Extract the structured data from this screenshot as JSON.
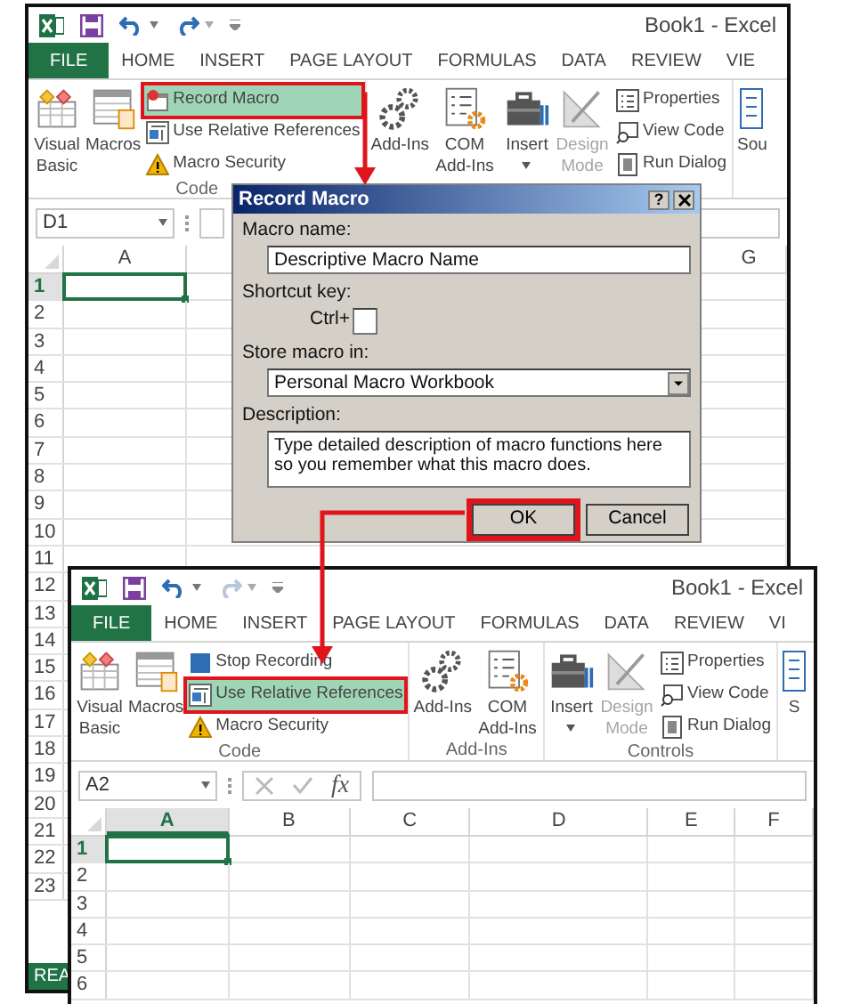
{
  "windows": [
    {
      "title": "Book1 - Excel",
      "redo_enabled": true,
      "tabs": [
        {
          "label": "FILE",
          "kind": "file",
          "selected": false
        },
        {
          "label": "HOME",
          "kind": "tab",
          "selected": false
        },
        {
          "label": "INSERT",
          "kind": "tab",
          "selected": false
        },
        {
          "label": "PAGE LAYOUT",
          "kind": "tab",
          "selected": false
        },
        {
          "label": "FORMULAS",
          "kind": "tab",
          "selected": false
        },
        {
          "label": "DATA",
          "kind": "tab",
          "selected": false
        },
        {
          "label": "REVIEW",
          "kind": "tab",
          "selected": false
        },
        {
          "label": "VIE",
          "kind": "tab",
          "selected": false
        }
      ],
      "groups": [
        {
          "label": "Code",
          "large": [
            {
              "label": "Visual Basic",
              "kind": "visual-basic",
              "disabled": false
            },
            {
              "label": "Macros",
              "kind": "macros",
              "disabled": false
            }
          ],
          "small": [
            {
              "label": "Record Macro",
              "kind": "record",
              "highlighted": true
            },
            {
              "label": "Use Relative References",
              "kind": "relative",
              "highlighted": false
            },
            {
              "label": "Macro Security",
              "kind": "security",
              "highlighted": false
            }
          ]
        },
        {
          "large": [
            {
              "label": "Add-Ins",
              "kind": "add-ins",
              "disabled": false
            },
            {
              "label": "COM Add-Ins",
              "kind": "com",
              "disabled": false
            }
          ]
        },
        {
          "large": [
            {
              "label": "Insert",
              "kind": "insert",
              "disabled": false
            },
            {
              "label": "Design Mode",
              "kind": "design",
              "disabled": true
            }
          ],
          "small": [
            {
              "label": "Properties",
              "kind": "properties",
              "highlighted": false
            },
            {
              "label": "View Code",
              "kind": "view-code",
              "highlighted": false
            },
            {
              "label": "Run Dialog",
              "kind": "run-dialog",
              "highlighted": false
            }
          ]
        },
        {
          "large": [
            {
              "label": "Sou",
              "kind": "source",
              "disabled": false
            }
          ]
        }
      ],
      "name_box": "D1",
      "columns": [
        {
          "label": "A",
          "selected": false
        },
        {
          "label": "G",
          "selected": false
        }
      ],
      "rows": [
        {
          "label": "1",
          "selected": true
        },
        {
          "label": "2",
          "selected": false
        },
        {
          "label": "3",
          "selected": false
        },
        {
          "label": "4",
          "selected": false
        },
        {
          "label": "5",
          "selected": false
        },
        {
          "label": "6",
          "selected": false
        },
        {
          "label": "7",
          "selected": false
        },
        {
          "label": "8",
          "selected": false
        },
        {
          "label": "9",
          "selected": false
        },
        {
          "label": "10",
          "selected": false
        },
        {
          "label": "11",
          "selected": false
        },
        {
          "label": "12",
          "selected": false
        },
        {
          "label": "13",
          "selected": false
        },
        {
          "label": "14",
          "selected": false
        },
        {
          "label": "15",
          "selected": false
        },
        {
          "label": "16",
          "selected": false
        },
        {
          "label": "17",
          "selected": false
        },
        {
          "label": "18",
          "selected": false
        },
        {
          "label": "19",
          "selected": false
        },
        {
          "label": "20",
          "selected": false
        },
        {
          "label": "21",
          "selected": false
        },
        {
          "label": "22",
          "selected": false
        },
        {
          "label": "23",
          "selected": false
        }
      ],
      "status": "REA"
    },
    {
      "title": "Book1 - Excel",
      "redo_enabled": false,
      "tabs": [
        {
          "label": "FILE",
          "kind": "file",
          "selected": false
        },
        {
          "label": "HOME",
          "kind": "tab",
          "selected": false
        },
        {
          "label": "INSERT",
          "kind": "tab",
          "selected": false
        },
        {
          "label": "PAGE LAYOUT",
          "kind": "tab",
          "selected": false
        },
        {
          "label": "FORMULAS",
          "kind": "tab",
          "selected": false
        },
        {
          "label": "DATA",
          "kind": "tab",
          "selected": false
        },
        {
          "label": "REVIEW",
          "kind": "tab",
          "selected": false
        },
        {
          "label": "VI",
          "kind": "tab",
          "selected": false
        }
      ],
      "groups": [
        {
          "label": "Code",
          "large": [
            {
              "label": "Visual Basic",
              "kind": "visual-basic",
              "disabled": false
            },
            {
              "label": "Macros",
              "kind": "macros",
              "disabled": false
            }
          ],
          "small": [
            {
              "label": "Stop Recording",
              "kind": "stop",
              "highlighted": false
            },
            {
              "label": "Use Relative References",
              "kind": "relative",
              "highlighted": true
            },
            {
              "label": "Macro Security",
              "kind": "security",
              "highlighted": false
            }
          ]
        },
        {
          "label": "Add-Ins",
          "large": [
            {
              "label": "Add-Ins",
              "kind": "add-ins",
              "disabled": false
            },
            {
              "label": "COM Add-Ins",
              "kind": "com",
              "disabled": false
            }
          ]
        },
        {
          "label": "Controls",
          "large": [
            {
              "label": "Insert",
              "kind": "insert",
              "disabled": false
            },
            {
              "label": "Design Mode",
              "kind": "design",
              "disabled": true
            }
          ],
          "small": [
            {
              "label": "Properties",
              "kind": "properties",
              "highlighted": false
            },
            {
              "label": "View Code",
              "kind": "view-code",
              "highlighted": false
            },
            {
              "label": "Run Dialog",
              "kind": "run-dialog",
              "highlighted": false
            }
          ]
        },
        {
          "large": [
            {
              "label": "S",
              "kind": "source",
              "disabled": false
            }
          ]
        }
      ],
      "name_box": "A2",
      "fx": "fx",
      "columns": [
        {
          "label": "A",
          "selected": true
        },
        {
          "label": "B",
          "selected": false
        },
        {
          "label": "C",
          "selected": false
        },
        {
          "label": "D",
          "selected": false
        },
        {
          "label": "E",
          "selected": false
        },
        {
          "label": "F",
          "selected": false
        }
      ],
      "rows": [
        {
          "label": "1",
          "selected": true
        },
        {
          "label": "2",
          "selected": false
        },
        {
          "label": "3",
          "selected": false
        },
        {
          "label": "4",
          "selected": false
        },
        {
          "label": "5",
          "selected": false
        },
        {
          "label": "6",
          "selected": false
        }
      ]
    }
  ],
  "dialog": {
    "title": "Record Macro",
    "help": "?",
    "macro_name": {
      "label": "Macro name:",
      "value": "Descriptive Macro Name"
    },
    "shortcut": {
      "label": "Shortcut key:",
      "prefix": "Ctrl+"
    },
    "store": {
      "label": "Store macro in:",
      "value": "Personal Macro Workbook"
    },
    "description": {
      "label": "Description:",
      "value": "Type detailed description of macro functions here so you remember what this macro does."
    },
    "buttons": [
      {
        "label": "OK",
        "highlighted": true
      },
      {
        "label": "Cancel",
        "highlighted": false
      }
    ]
  }
}
